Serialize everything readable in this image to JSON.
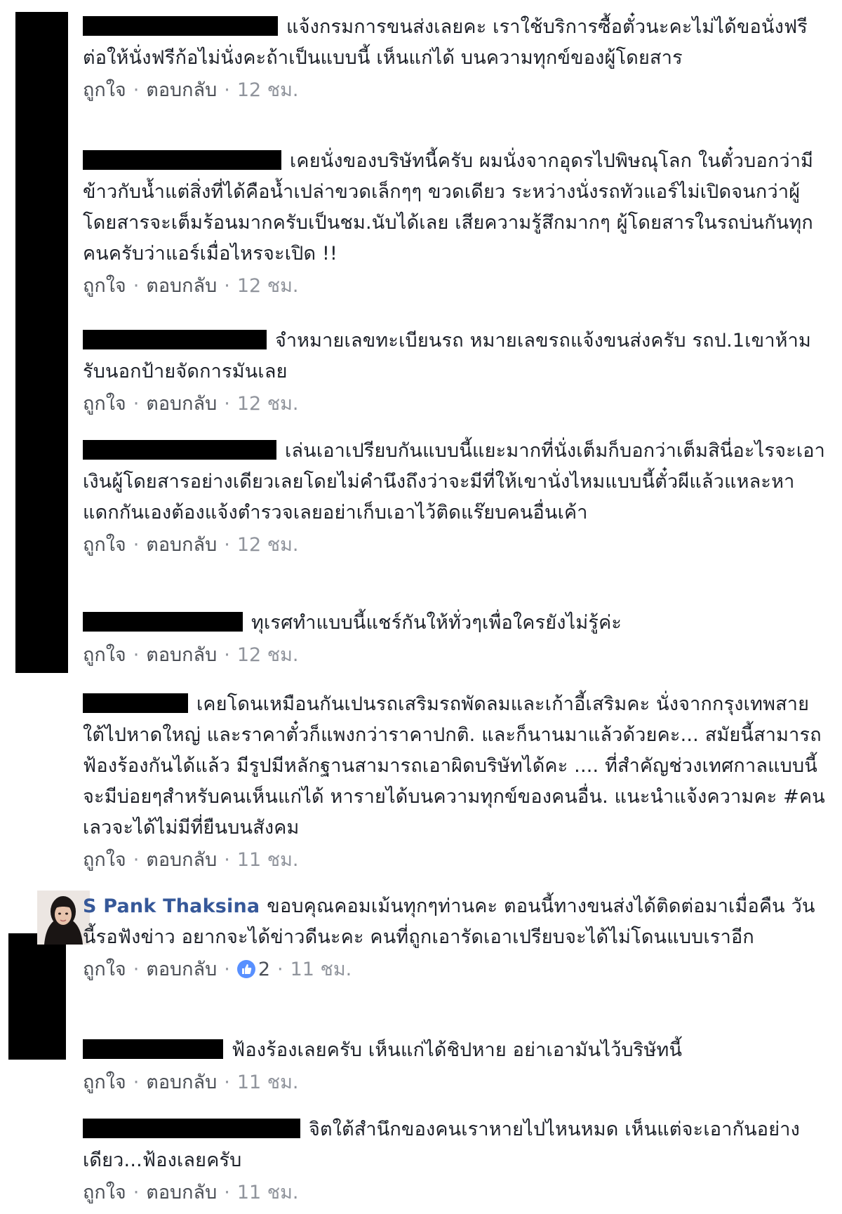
{
  "labels": {
    "like": "ถูกใจ",
    "reply": "ตอบกลับ",
    "separator": "·"
  },
  "comments": [
    {
      "text": "แจ้งกรมการขนส่งเลยคะ เราใช้บริการซื้อตั๋วนะคะไม่ได้ขอนั่งฟรี ต่อให้นั่งฟรีก้อไม่นั่งคะถ้าเป็นแบบนี้ เห็นแก่ได้ บนความทุกข์ของผู้โดยสาร",
      "time": "12 ชม."
    },
    {
      "text": "เคยนั่งของบริษัทนี้ครับ ผมนั่งจากอุดรไปพิษณุโลก ในตั๋วบอกว่ามีข้าวกับน้ำแต่สิ่งที่ได้คือน้ำเปล่าขวดเล็กๆๆ ขวดเดียว ระหว่างนั่งรถทัวแอร์ไม่เปิดจนกว่าผู้โดยสารจะเต็มร้อนมากครับเป็นชม.นับได้เลย เสียความรู้สึกมากๆ ผู้โดยสารในรถบ่นกันทุกคนครับว่าแอร์เมื่อไหรจะเปิด !!",
      "time": "12 ชม."
    },
    {
      "text": "จำหมายเลขทะเบียนรถ หมายเลขรถแจ้งขนส่งครับ รถป.1เขาห้ามรับนอกป้ายจัดการมันเลย",
      "time": "12 ชม."
    },
    {
      "text": "เล่นเอาเปรียบกันแบบนี้แยะมากที่นั่งเต็มก็บอกว่าเต็มสินี่อะไรจะเอาเงินผู้โดยสารอย่างเดียวเลยโดยไม่คำนึงถึงว่าจะมีที่ให้เขานั่งไหมแบบนี้ตั๋วผีแล้วแหละหาแดกกันเองต้องแจ้งตำรวจเลยอย่าเก็บเอาไว้ติดแร๊ยบคนอื่นเค้า",
      "time": "12 ชม."
    },
    {
      "text": "ทุเรศทำแบบนี้แชร์กันให้ทั่วๆเพื่อใครยังไม่รู้ค่ะ",
      "time": "12 ชม."
    },
    {
      "text": "เคยโดนเหมือนกันเปนรถเสริมรถพัดลมและเก้าอี้เสริมคะ นั่งจากกรุงเทพสายใต้ไปหาดใหญ่ และราคาตั๋วก็แพงกว่าราคาปกติ. และก็นานมาแล้วด้วยคะ... สมัยนี้สามารถฟ้องร้องกันได้แล้ว มีรูปมีหลักฐานสามารถเอาผิดบริษัทได้คะ .... ที่สำคัญช่วงเทศกาลแบบนี้จะมีบ่อยๆสำหรับคนเห็นแก่ได้ หารายได้บนความทุกข์ของคนอื่น. แนะนำแจ้งความคะ #คนเลวจะได้ไม่มีที่ยืนบนสังคม",
      "time": "11 ชม."
    },
    {
      "author": "S Pank Thaksina",
      "text": "ขอบคุณคอมเม้นทุกๆท่านคะ ตอนนี้ทางขนส่งได้ติดต่อมาเมื่อคืน วันนี้รอฟังข่าว อยากจะได้ข่าวดีนะคะ คนที่ถูกเอารัดเอาเปรียบจะได้ไม่โดนแบบเราอีก",
      "likes": "2",
      "time": "11 ชม."
    },
    {
      "text": "ฟ้องร้องเลยครับ เห็นแก่ได้ชิปหาย อย่าเอามันไว้บริษัทนี้",
      "time": "11 ชม."
    },
    {
      "text": "จิตใต้สำนึกของคนเราหายไปไหนหมด เห็นแต่จะเอากันอย่างเดียว...ฟ้องเลยครับ",
      "time": "11 ชม."
    }
  ]
}
